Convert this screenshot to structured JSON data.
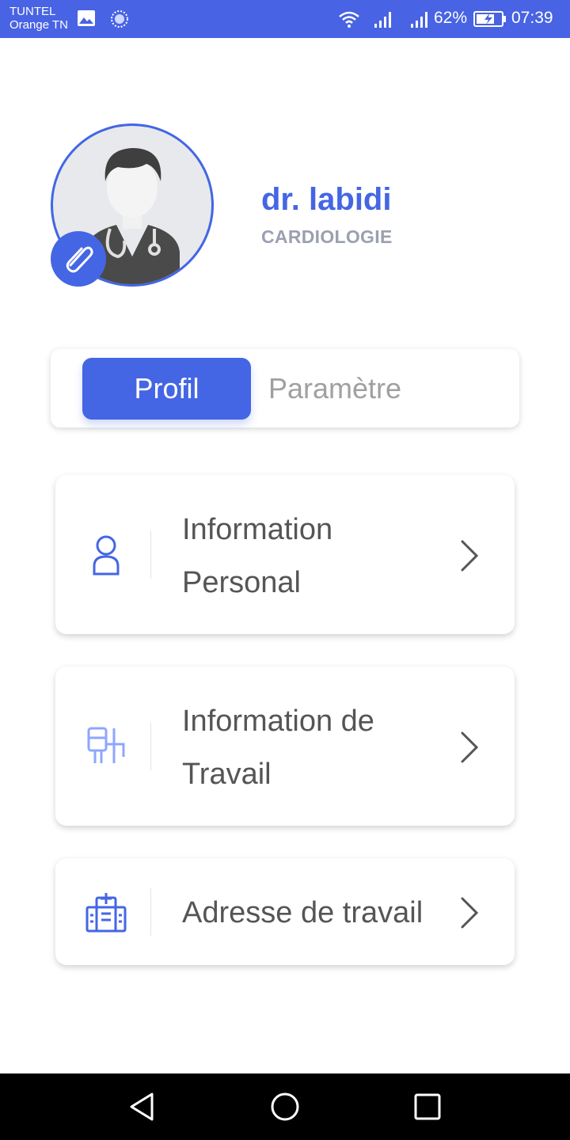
{
  "status_bar": {
    "carrier_line1": "TUNTEL",
    "carrier_line2": "Orange TN",
    "battery": "62%",
    "time": "07:39",
    "icons": [
      "image-icon",
      "sync-icon",
      "wifi-icon",
      "signal-icon",
      "signal-icon",
      "battery-charging-icon"
    ]
  },
  "profile": {
    "name": "dr. labidi",
    "specialty": "CARDIOLOGIE",
    "avatar_icon": "doctor-avatar-icon",
    "edit_icon": "paperclip-icon"
  },
  "tabs": [
    {
      "label": "Profil",
      "active": true
    },
    {
      "label": "Paramètre",
      "active": false
    }
  ],
  "cards": [
    {
      "label_line1": "Information",
      "label_line2": "Personal",
      "icon": "person-icon"
    },
    {
      "label_line1": "Information de",
      "label_line2": "Travail",
      "icon": "medical-equipment-icon"
    },
    {
      "label": "Adresse de travail",
      "icon": "hospital-icon"
    }
  ],
  "colors": {
    "accent": "#4466e4",
    "status_bar": "#4863e3",
    "specialty_text": "#9aa0ae",
    "card_text": "#555555",
    "inactive_tab": "#a0a0a0"
  },
  "nav": [
    "back-icon",
    "home-icon",
    "recents-icon"
  ]
}
